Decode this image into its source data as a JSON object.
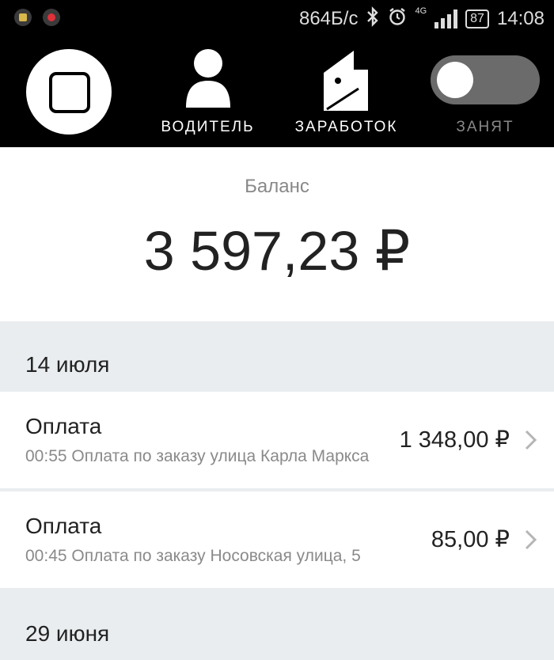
{
  "status_bar": {
    "network_speed": "864Б/с",
    "network_type": "4G",
    "battery": "87",
    "time": "14:08",
    "icons": [
      "sim-icon",
      "record-icon",
      "bluetooth-icon",
      "alarm-icon",
      "signal-icon",
      "battery-icon"
    ]
  },
  "nav": {
    "driver_label": "ВОДИТЕЛЬ",
    "earnings_label": "ЗАРАБОТОК",
    "busy_label": "ЗАНЯТ",
    "busy_toggle_on": false,
    "icons": [
      "stop-square-icon",
      "person-icon",
      "wallet-icon"
    ]
  },
  "balance": {
    "label": "Баланс",
    "amount": "3 597,23 ₽"
  },
  "groups": [
    {
      "date": "14 июля",
      "transactions": [
        {
          "title": "Оплата",
          "description": "00:55 Оплата по заказу улица Карла Маркса",
          "amount": "1 348,00 ₽"
        },
        {
          "title": "Оплата",
          "description": "00:45 Оплата по заказу Носовская улица, 5",
          "amount": "85,00 ₽"
        }
      ]
    },
    {
      "date": "29 июня",
      "transactions": []
    }
  ],
  "colors": {
    "top_bar_bg": "#000000",
    "list_bg": "#eaedf0",
    "secondary_text": "#8a8a8a",
    "toggle_track": "#6b6b6b"
  }
}
